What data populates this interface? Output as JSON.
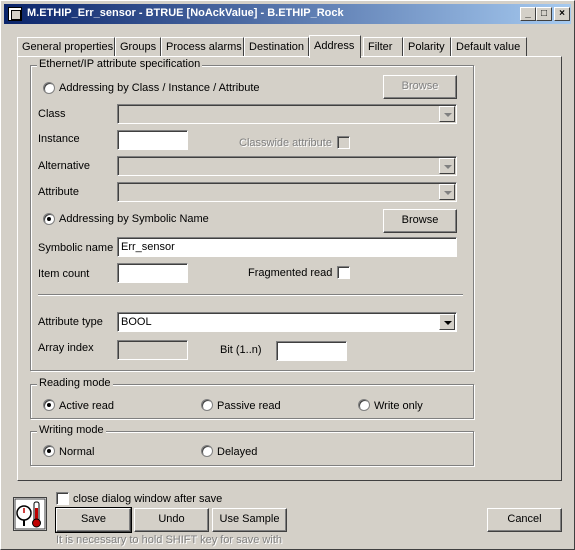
{
  "window": {
    "title": "M.ETHIP_Err_sensor - BTRUE [NoAckValue] - B.ETHIP_Rock",
    "minimize": "_",
    "maximize": "□",
    "close": "×"
  },
  "tabs": [
    {
      "label": "General properties"
    },
    {
      "label": "Groups"
    },
    {
      "label": "Process alarms"
    },
    {
      "label": "Destination"
    },
    {
      "label": "Address",
      "active": true
    },
    {
      "label": "Filter"
    },
    {
      "label": "Polarity"
    },
    {
      "label": "Default value"
    }
  ],
  "ethip": {
    "group_label": "Ethernet/IP attribute specification",
    "by_class_label": "Addressing by Class / Instance / Attribute",
    "browse_1": "Browse",
    "class_label": "Class",
    "class_value": "",
    "instance_label": "Instance",
    "instance_value": "",
    "classwide_label": "Classwide attribute",
    "alternative_label": "Alternative",
    "alternative_value": "",
    "attribute_label": "Attribute",
    "attribute_value": "",
    "by_symbolic_label": "Addressing by Symbolic Name",
    "browse_2": "Browse",
    "symbolic_name_label": "Symbolic name",
    "symbolic_name_value": "Err_sensor",
    "item_count_label": "Item count",
    "item_count_value": "",
    "fragmented_label": "Fragmented read",
    "attribute_type_label": "Attribute type",
    "attribute_type_value": "BOOL",
    "array_index_label": "Array index",
    "array_index_value": "",
    "bit_label": "Bit (1..n)",
    "bit_value": ""
  },
  "reading_mode": {
    "label": "Reading mode",
    "options": [
      "Active read",
      "Passive read",
      "Write only"
    ],
    "selected": "Active read"
  },
  "writing_mode": {
    "label": "Writing mode",
    "options": [
      "Normal",
      "Delayed"
    ],
    "selected": "Normal"
  },
  "footer": {
    "close_after_save_label": "close dialog window after save",
    "save": "Save",
    "undo": "Undo",
    "use_sample": "Use Sample",
    "cancel": "Cancel",
    "hint": "It is necessary to hold SHIFT key for save with"
  },
  "colors": {
    "face": "#d4d0c8",
    "title_start": "#0a246a",
    "title_end": "#a6caf0",
    "disabled_text": "#808080"
  }
}
